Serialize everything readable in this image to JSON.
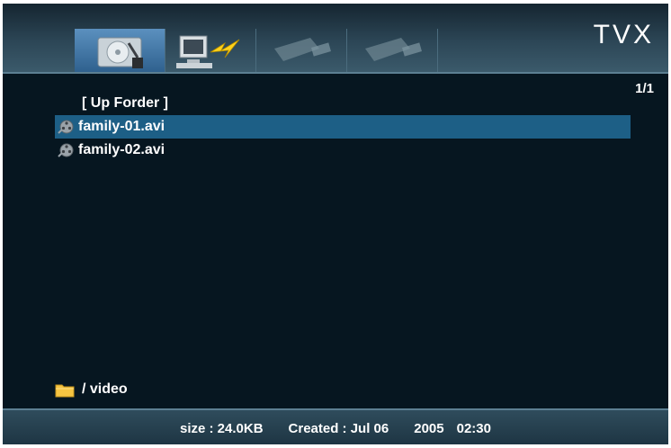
{
  "brand": "TVX",
  "tabs": [
    {
      "icon": "hard-drive-icon",
      "active": true
    },
    {
      "icon": "network-computer-icon",
      "active": false
    },
    {
      "icon": "usb-icon",
      "active": false
    },
    {
      "icon": "usb-icon",
      "active": false
    }
  ],
  "page_indicator": "1/1",
  "list": {
    "up_folder": "[ Up Forder ]",
    "items": [
      {
        "name": "family-01.avi",
        "icon": "film-reel-icon",
        "selected": true
      },
      {
        "name": "family-02.avi",
        "icon": "film-reel-icon",
        "selected": false
      }
    ]
  },
  "path": {
    "icon": "folder-icon",
    "text": "/ video"
  },
  "status": {
    "size": "size : 24.0KB",
    "created": "Created : Jul 06",
    "year": "2005",
    "time": "02:30"
  },
  "colors": {
    "selection": "#1d5f86",
    "background": "#061620",
    "bar": "#2c4656"
  }
}
